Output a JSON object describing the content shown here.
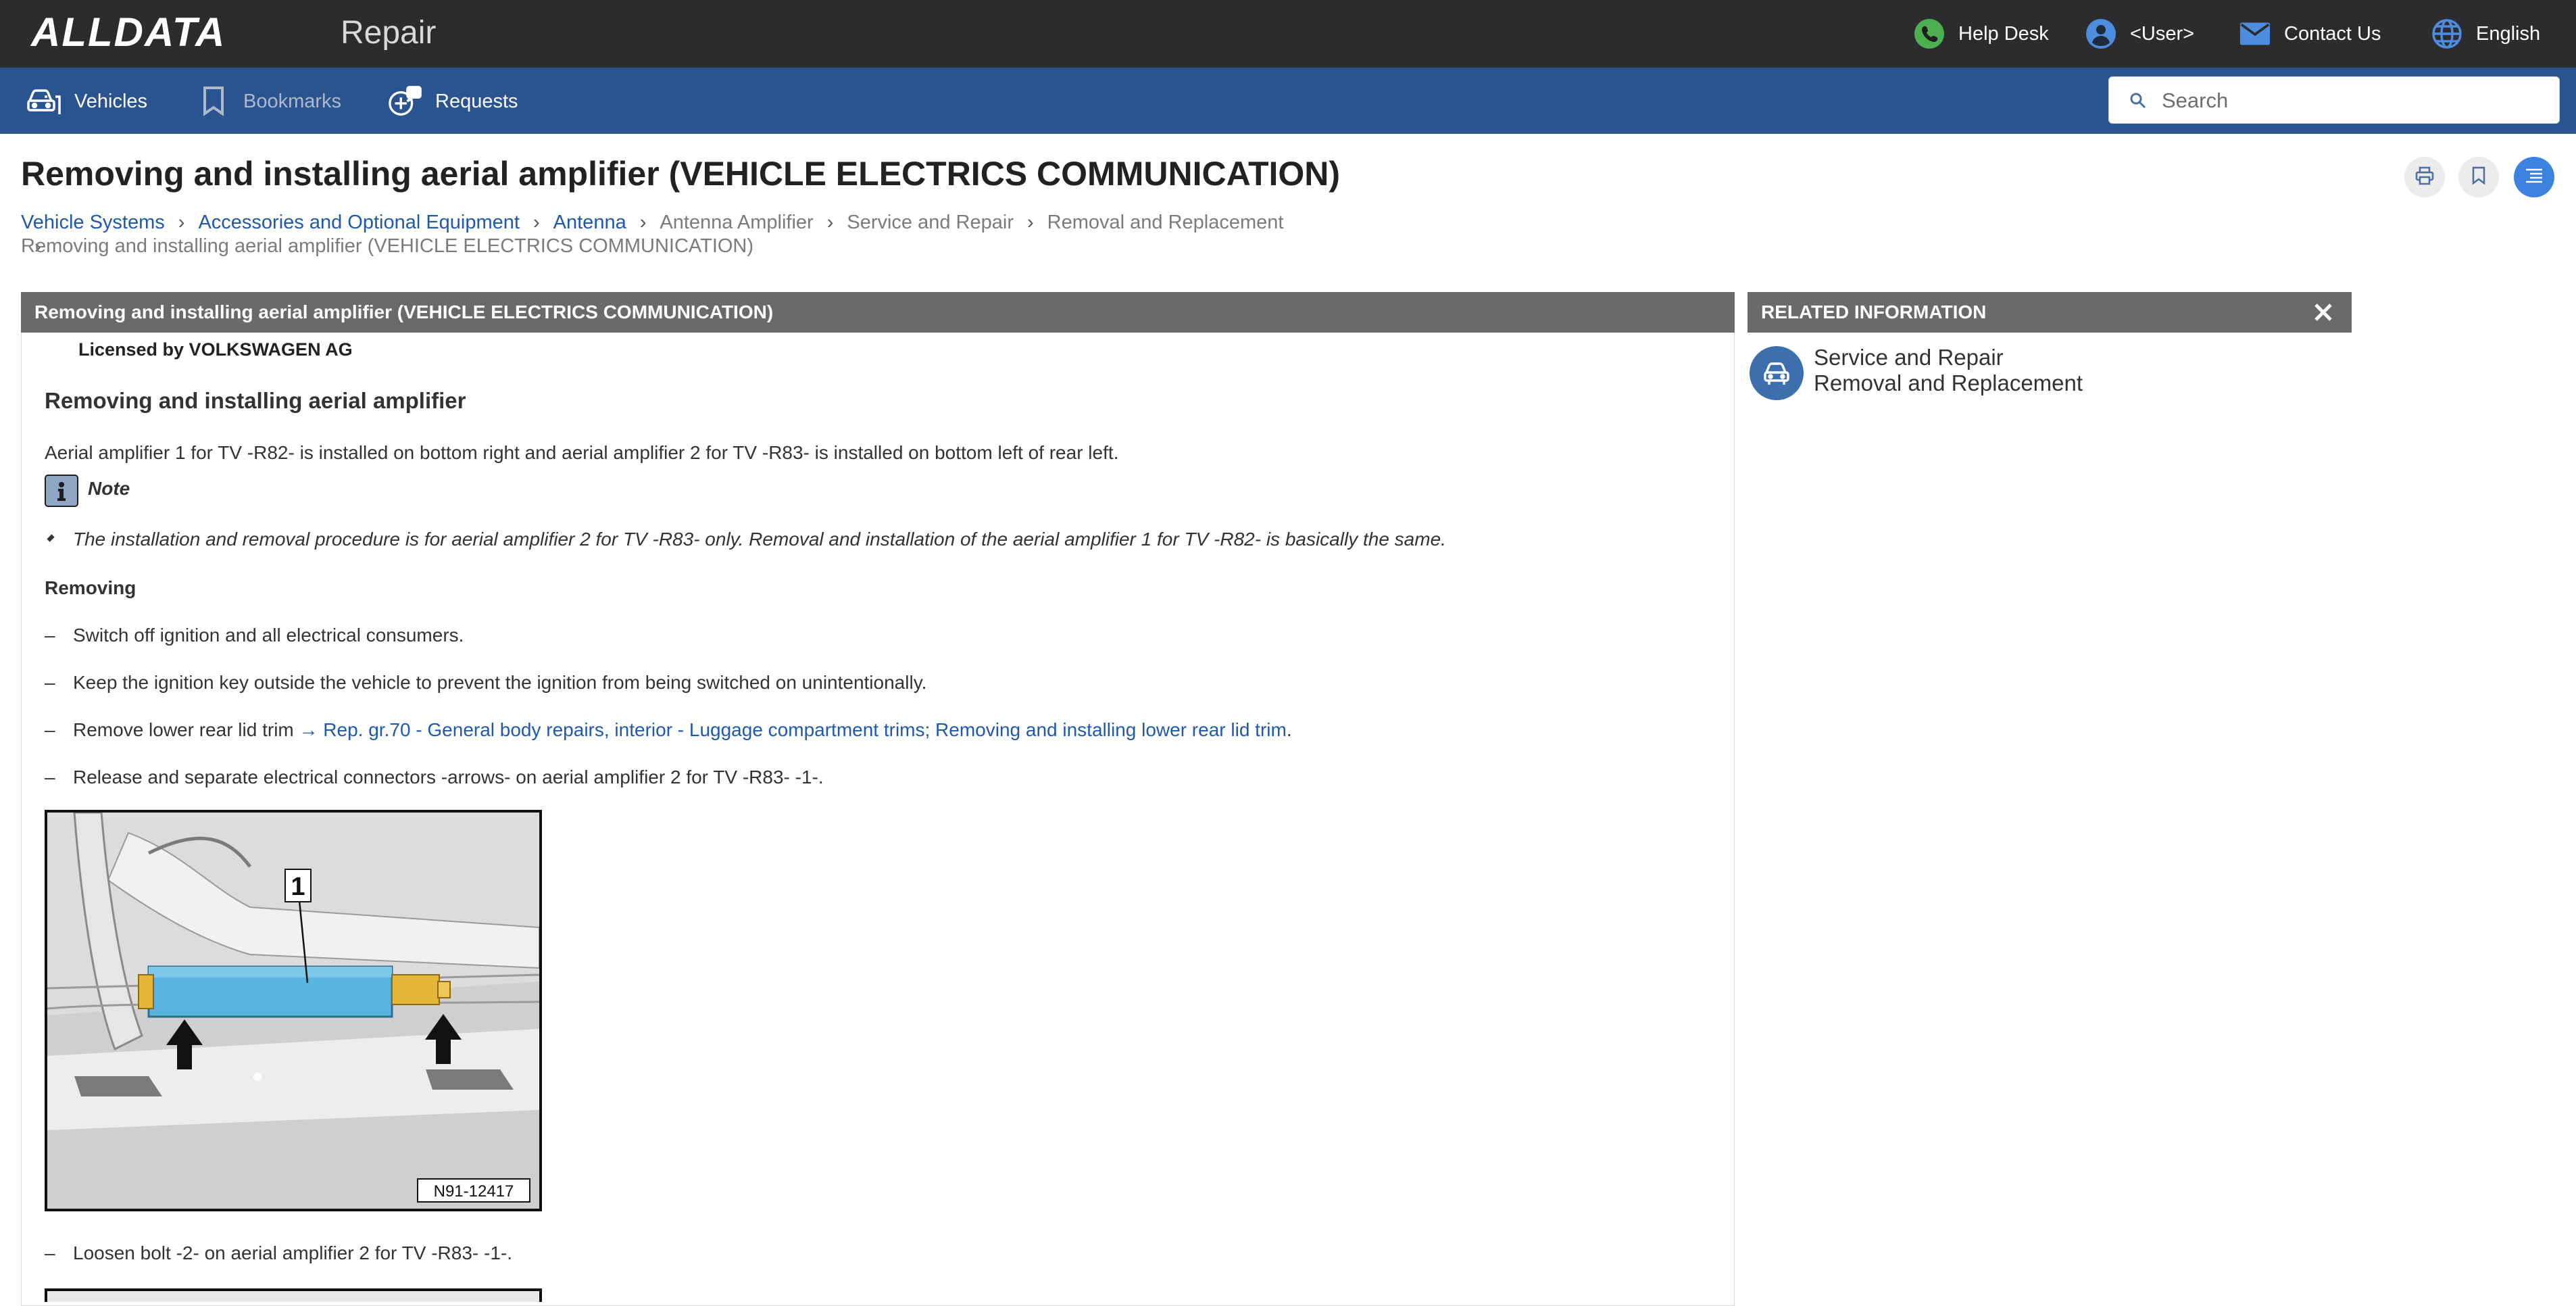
{
  "header": {
    "logo": "ALLDATA",
    "app_name": "Repair",
    "help_desk": "Help Desk",
    "user": "<User>",
    "contact_us": "Contact Us",
    "language": "English"
  },
  "nav": {
    "vehicles": "Vehicles",
    "bookmarks": "Bookmarks",
    "requests": "Requests",
    "search_placeholder": "Search"
  },
  "page": {
    "title": "Removing and installing aerial amplifier (VEHICLE ELECTRICS COMMUNICATION)"
  },
  "breadcrumb": [
    "Vehicle Systems",
    "Accessories and Optional Equipment",
    "Antenna",
    "Antenna Amplifier",
    "Service and Repair",
    "Removal and Replacement",
    "Removing and installing aerial amplifier (VEHICLE ELECTRICS COMMUNICATION)"
  ],
  "document": {
    "header": "Removing and installing aerial amplifier (VEHICLE ELECTRICS COMMUNICATION)",
    "licensed": "Licensed by VOLKSWAGEN AG",
    "section_title": "Removing and installing aerial amplifier",
    "intro": "Aerial amplifier 1 for TV -R82- is installed on bottom right and aerial amplifier 2 for TV -R83- is installed on bottom left of rear left.",
    "note_label": "Note",
    "note_text": "The installation and removal procedure is for aerial amplifier 2 for TV -R83- only. Removal and installation of the aerial amplifier 1 for TV -R82- is basically the same.",
    "removing_heading": "Removing",
    "dash": "–",
    "steps": [
      "Switch off ignition and all electrical consumers.",
      "Keep the ignition key outside the vehicle to prevent the ignition from being switched on unintentionally.",
      "Remove lower rear lid trim ",
      "Release and separate electrical connectors -arrows- on aerial amplifier 2 for TV -R83- -1-.",
      "Loosen bolt -2- on aerial amplifier 2 for TV -R83- -1-."
    ],
    "step3_link": "→ Rep. gr.70 - General body repairs, interior - Luggage compartment trims; Removing and installing lower rear lid trim",
    "step3_end": ".",
    "figure_callout": "1",
    "figure_id": "N91-12417"
  },
  "related": {
    "header": "RELATED INFORMATION",
    "line1": "Service and Repair",
    "line2": "Removal and Replacement"
  },
  "colors": {
    "topbar": "#2c2c2e",
    "navbar": "#2a5490",
    "link": "#1f59ad",
    "panel_header": "#6a6a6a",
    "amplifier": "#5ab4e0",
    "connector": "#e5b53a"
  },
  "icons": [
    "phone-icon",
    "user-icon",
    "mail-icon",
    "globe-icon",
    "car-icon",
    "bookmark-icon",
    "requests-icon",
    "search-icon",
    "print-icon",
    "bookmark-add-icon",
    "toc-icon",
    "chevron-right-icon",
    "info-note-icon",
    "close-icon",
    "service-repair-icon"
  ]
}
